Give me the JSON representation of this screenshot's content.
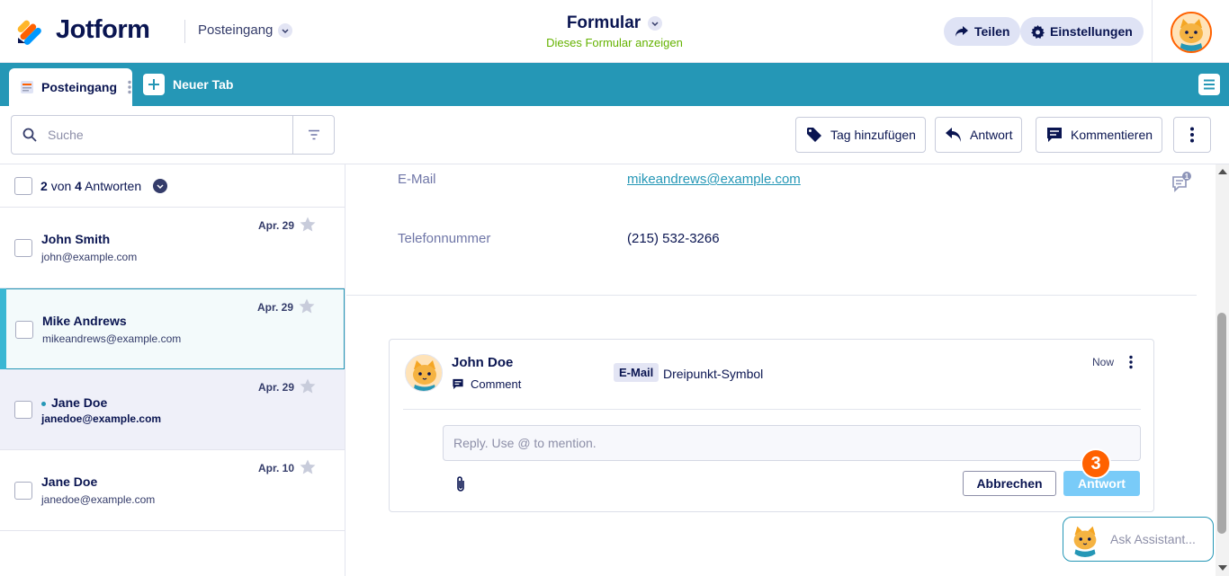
{
  "header": {
    "logo_text": "Jotform",
    "inbox_label": "Posteingang",
    "form_title": "Formular",
    "form_subtitle": "Dieses Formular anzeigen",
    "share_label": "Teilen",
    "settings_label": "Einstellungen"
  },
  "tabs": {
    "active_label": "Posteingang",
    "new_tab_label": "Neuer Tab"
  },
  "toolbar": {
    "search_placeholder": "Suche",
    "add_tag_label": "Tag hinzufügen",
    "reply_label": "Antwort",
    "comment_label": "Kommentieren"
  },
  "list": {
    "count_shown": "2",
    "count_of": "von",
    "count_total": "4",
    "count_suffix": "Antworten",
    "items": [
      {
        "name": "John Smith",
        "email": "john@example.com",
        "date": "Apr. 29"
      },
      {
        "name": "Mike Andrews",
        "email": "mikeandrews@example.com",
        "date": "Apr. 29"
      },
      {
        "name": "Jane Doe",
        "email": "janedoe@example.com",
        "date": "Apr. 29"
      },
      {
        "name": "Jane Doe",
        "email": "janedoe@example.com",
        "date": "Apr. 10"
      }
    ]
  },
  "detail": {
    "fields": [
      {
        "label": "E-Mail",
        "value": "mikeandrews@example.com"
      },
      {
        "label": "Telefonnummer",
        "value": "(215) 532-3266"
      }
    ],
    "comment_badge_count": "1"
  },
  "comment": {
    "author": "John Doe",
    "type": "Comment",
    "tag": "E-Mail",
    "tag_text": "Dreipunkt-Symbol",
    "time": "Now",
    "reply_placeholder": "Reply. Use @ to mention.",
    "cancel_label": "Abbrechen",
    "send_label": "Antwort"
  },
  "step_badge": "3",
  "assistant": {
    "placeholder": "Ask Assistant..."
  },
  "colors": {
    "brand_teal": "#2597b6",
    "navy": "#0a1551",
    "accent_orange": "#ff6100",
    "green": "#64b200",
    "send_blue": "#79cbf8"
  }
}
